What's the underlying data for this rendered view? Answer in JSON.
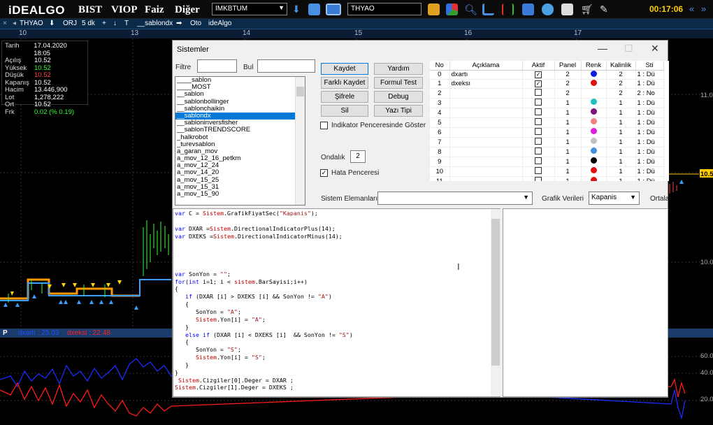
{
  "app": {
    "logo": "iDEALGO",
    "menu": [
      "BIST",
      "VIOP",
      "Faiz",
      "Diğer"
    ],
    "combo1": "IMKBTUM",
    "combo2": "THYAO",
    "clock": "00:17:06"
  },
  "chartbar": {
    "symbol": "THYAO",
    "items": [
      "ORJ",
      "5 dk",
      "+",
      "↓",
      "T",
      "__sablondx",
      "Oto",
      "ideAlgo"
    ]
  },
  "dates": [
    "10",
    "13",
    "14",
    "15",
    "16",
    "17"
  ],
  "info": [
    {
      "k": "Tarih",
      "v": "17.04.2020 18:05",
      "c": "#ffffff"
    },
    {
      "k": "Açılış",
      "v": "10.52",
      "c": "#ffffff"
    },
    {
      "k": "Yüksek",
      "v": "10.52",
      "c": "#33ff33"
    },
    {
      "k": "Düşük",
      "v": "10.52",
      "c": "#ff4444"
    },
    {
      "k": "Kapanış",
      "v": "10.52",
      "c": "#ffffff"
    },
    {
      "k": "Hacim",
      "v": "13.446,900",
      "c": "#ffffff"
    },
    {
      "k": "Lot",
      "v": "1,278,222",
      "c": "#ffffff"
    },
    {
      "k": "Ort",
      "v": "10.52",
      "c": "#ffffff"
    },
    {
      "k": "Frk",
      "v": "0.02 (% 0.19)",
      "c": "#33ff33"
    }
  ],
  "price_axis": [
    "11.0",
    "10.5",
    "10.0"
  ],
  "ind_axis": [
    "60.0",
    "40.0",
    "20.0"
  ],
  "ind_label": {
    "p": "P",
    "dxarti": "dxartı : 25.03",
    "dxeksi": "dxeksi : 22.48"
  },
  "dialog": {
    "title": "Sistemler",
    "filtre_label": "Filtre",
    "bul_label": "Bul",
    "systems": [
      "____sablon",
      "____MOST",
      "__sablon",
      "__sablonbollinger",
      "__sablonchaikin",
      "__sablondx",
      "__sabloninversfisher",
      "__sablonTRENDSCORE",
      "_halkrobot",
      "_turevsablon",
      "a_garan_mov",
      "a_mov_12_16_petkm",
      "a_mov_12_24",
      "a_mov_14_20",
      "a_mov_15_25",
      "a_mov_15_31",
      "a_mov_15_90"
    ],
    "selected_index": 5,
    "buttons": {
      "kaydet": "Kaydet",
      "yardim": "Yardım",
      "farkli": "Farklı Kaydet",
      "formul": "Formul Test",
      "sifrele": "Şifrele",
      "debug": "Debug",
      "sil": "Sil",
      "yazi": "Yazı Tipi"
    },
    "indicator_window": "Indikator Penceresinde Göster",
    "ondalik_label": "Ondalık",
    "ondalik_value": "2",
    "hata": "Hata Penceresi",
    "sistem_elemanlari": "Sistem Elemanları",
    "grafik_verileri": "Grafik Verileri",
    "grafik_value": "Kapanis",
    "ortala": "Ortala",
    "grid_headers": [
      "No",
      "Açıklama",
      "Aktif",
      "Panel",
      "Renk",
      "Kalinlik",
      "Sti"
    ],
    "grid_rows": [
      {
        "no": "0",
        "desc": "dxartı",
        "aktif": true,
        "panel": "2",
        "color": "#0a1ce0",
        "kal": "2",
        "sti": "1 : Dü"
      },
      {
        "no": "1",
        "desc": "dxeksı",
        "aktif": true,
        "panel": "2",
        "color": "#e01010",
        "kal": "2",
        "sti": "1 : Dü"
      },
      {
        "no": "2",
        "desc": "",
        "aktif": false,
        "panel": "2",
        "color": "",
        "kal": "2",
        "sti": "2 : No"
      },
      {
        "no": "3",
        "desc": "",
        "aktif": false,
        "panel": "1",
        "color": "#20c0c0",
        "kal": "1",
        "sti": "1 : Dü"
      },
      {
        "no": "4",
        "desc": "",
        "aktif": false,
        "panel": "1",
        "color": "#801080",
        "kal": "1",
        "sti": "1 : Dü"
      },
      {
        "no": "5",
        "desc": "",
        "aktif": false,
        "panel": "1",
        "color": "#f08080",
        "kal": "1",
        "sti": "1 : Dü"
      },
      {
        "no": "6",
        "desc": "",
        "aktif": false,
        "panel": "1",
        "color": "#e020e0",
        "kal": "1",
        "sti": "1 : Dü"
      },
      {
        "no": "7",
        "desc": "",
        "aktif": false,
        "panel": "1",
        "color": "#c0c0c0",
        "kal": "1",
        "sti": "1 : Dü"
      },
      {
        "no": "8",
        "desc": "",
        "aktif": false,
        "panel": "1",
        "color": "#4090e0",
        "kal": "1",
        "sti": "1 : Dü"
      },
      {
        "no": "9",
        "desc": "",
        "aktif": false,
        "panel": "1",
        "color": "#000000",
        "kal": "1",
        "sti": "1 : Dü"
      },
      {
        "no": "10",
        "desc": "",
        "aktif": false,
        "panel": "1",
        "color": "#e01010",
        "kal": "1",
        "sti": "1 : Dü"
      },
      {
        "no": "11",
        "desc": "",
        "aktif": false,
        "panel": "1",
        "color": "#e01010",
        "kal": "1",
        "sti": "1 : Dü"
      }
    ],
    "code": [
      "var C = Sistem.GrafikFiyatSec(\"Kapanis\");",
      "",
      "var DXAR =Sistem.DirectionalIndicatorPlus(14);",
      "var DXEKS =Sistem.DirectionalIndicatorMinus(14);",
      "",
      "",
      "",
      "",
      "var SonYon = \"\";",
      "for(int i=1; i < sistem.BarSayisi;i++)",
      "{",
      "   if (DXAR [i] > DXEKS [i] && SonYon != \"A\")",
      "   {",
      "      SonYon = \"A\";",
      "      Sistem.Yon[i] = \"A\";",
      "   }",
      "   else if (DXAR [i] < DXEKS [i]  && SonYon != \"S\")",
      "   {",
      "      SonYon = \"S\";",
      "      Sistem.Yon[i] = \"S\";",
      "   }",
      "}",
      " Sistem.Cizgiler[0].Deger = DXAR ;",
      "Sistem.Cizgiler[1].Deger = DXEKS ;"
    ]
  }
}
